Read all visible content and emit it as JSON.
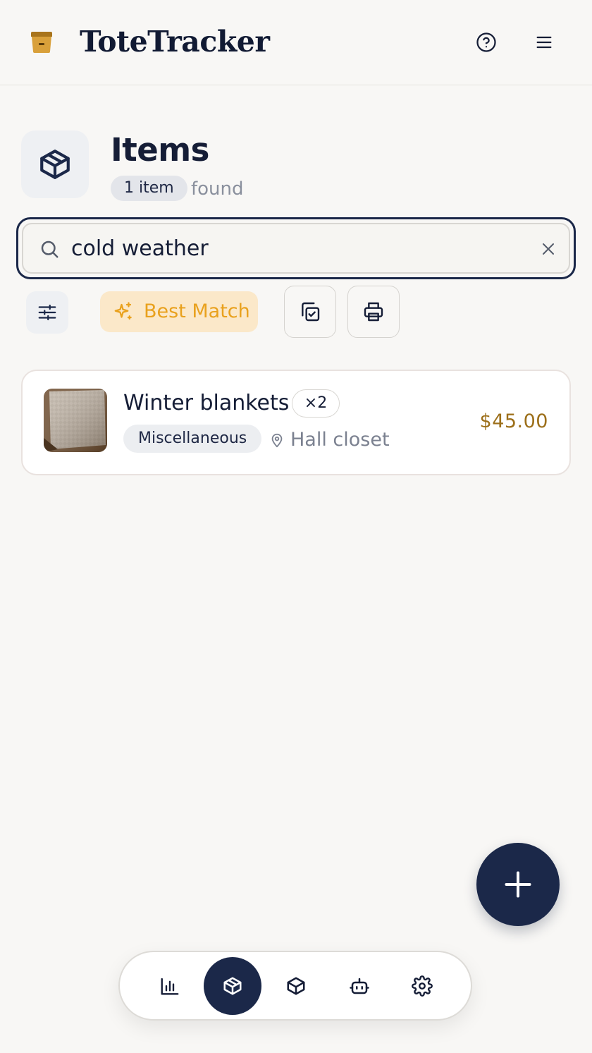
{
  "app": {
    "title": "ToteTracker",
    "icons": {
      "logo": "tote-box-icon",
      "help": "help-circle-icon",
      "menu": "hamburger-menu-icon"
    }
  },
  "page": {
    "title": "Items",
    "icon": "package-icon",
    "count_label": "1 item",
    "found_label": "found"
  },
  "search": {
    "value": "cold weather",
    "icon": "search-icon",
    "clear_icon": "close-icon"
  },
  "toolbar": {
    "filters_icon": "sliders-icon",
    "sort_label": "Best Match",
    "sort_icon": "sparkle-icon",
    "select_icon": "multi-select-icon",
    "print_icon": "printer-icon"
  },
  "items": [
    {
      "name": "Winter blankets",
      "quantity": "×2",
      "category": "Miscellaneous",
      "location": "Hall closet",
      "price": "$45.00",
      "thumbnail": "blanket-photo"
    }
  ],
  "fab": {
    "icon": "plus-icon"
  },
  "bottom_nav": [
    {
      "name": "stats",
      "icon": "bar-chart-icon",
      "active": false
    },
    {
      "name": "items",
      "icon": "package-icon",
      "active": true
    },
    {
      "name": "boxes",
      "icon": "box-icon",
      "active": false
    },
    {
      "name": "assistant",
      "icon": "robot-icon",
      "active": false
    },
    {
      "name": "settings",
      "icon": "gear-icon",
      "active": false
    }
  ],
  "colors": {
    "navy": "#1b2849",
    "accent_orange": "#e9a11d",
    "price_gold": "#9c6f1a",
    "background": "#f8f7f5"
  }
}
